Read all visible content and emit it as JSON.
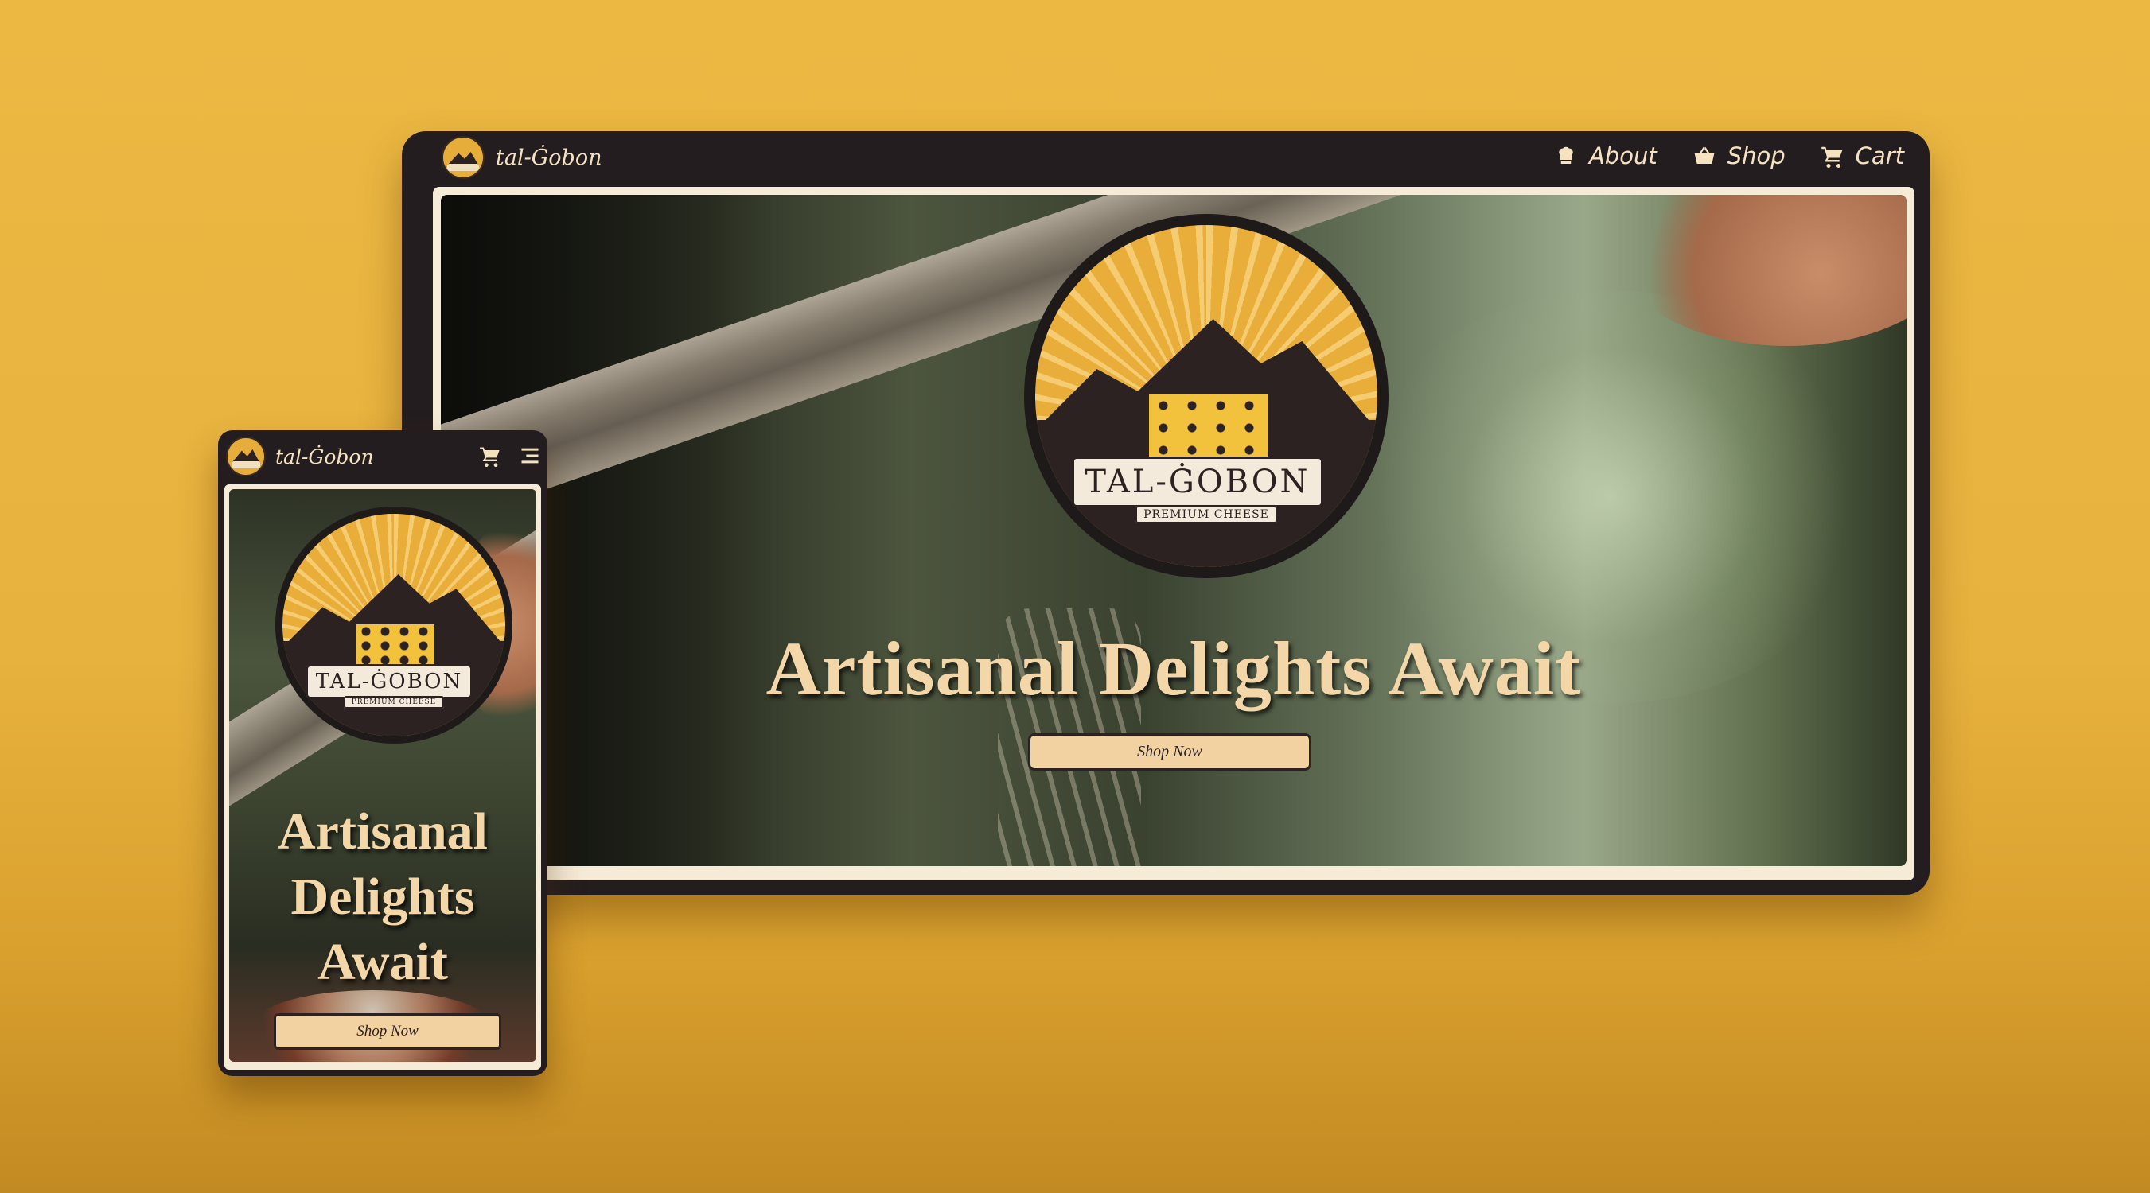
{
  "colors": {
    "background": "#ecb842",
    "nav_dark": "#241d1f",
    "frame_cream": "#f6ebd6",
    "headline": "#f3d7a9",
    "button": "#f3d2a2",
    "emblem_gold": "#e9ad3a"
  },
  "brand": {
    "name": "tal-Ġobon",
    "logo_icon": "cheese-mountain-logo-icon"
  },
  "desktop": {
    "nav": {
      "items": [
        {
          "label": "About",
          "icon": "chef-hat-icon"
        },
        {
          "label": "Shop",
          "icon": "basket-icon"
        },
        {
          "label": "Cart",
          "icon": "cart-icon"
        }
      ]
    },
    "hero": {
      "emblem": {
        "title": "TAL-ĠOBON",
        "subtitle": "PREMIUM CHEESE"
      },
      "headline": "Artisanal Delights Await",
      "cta_label": "Shop Now"
    }
  },
  "mobile": {
    "nav": {
      "icons": [
        "cart-icon",
        "hamburger-menu-icon"
      ]
    },
    "hero": {
      "emblem": {
        "title": "TAL-ĠOBON",
        "subtitle": "PREMIUM CHEESE"
      },
      "headline": "Artisanal Delights Await",
      "cta_label": "Shop Now"
    }
  }
}
